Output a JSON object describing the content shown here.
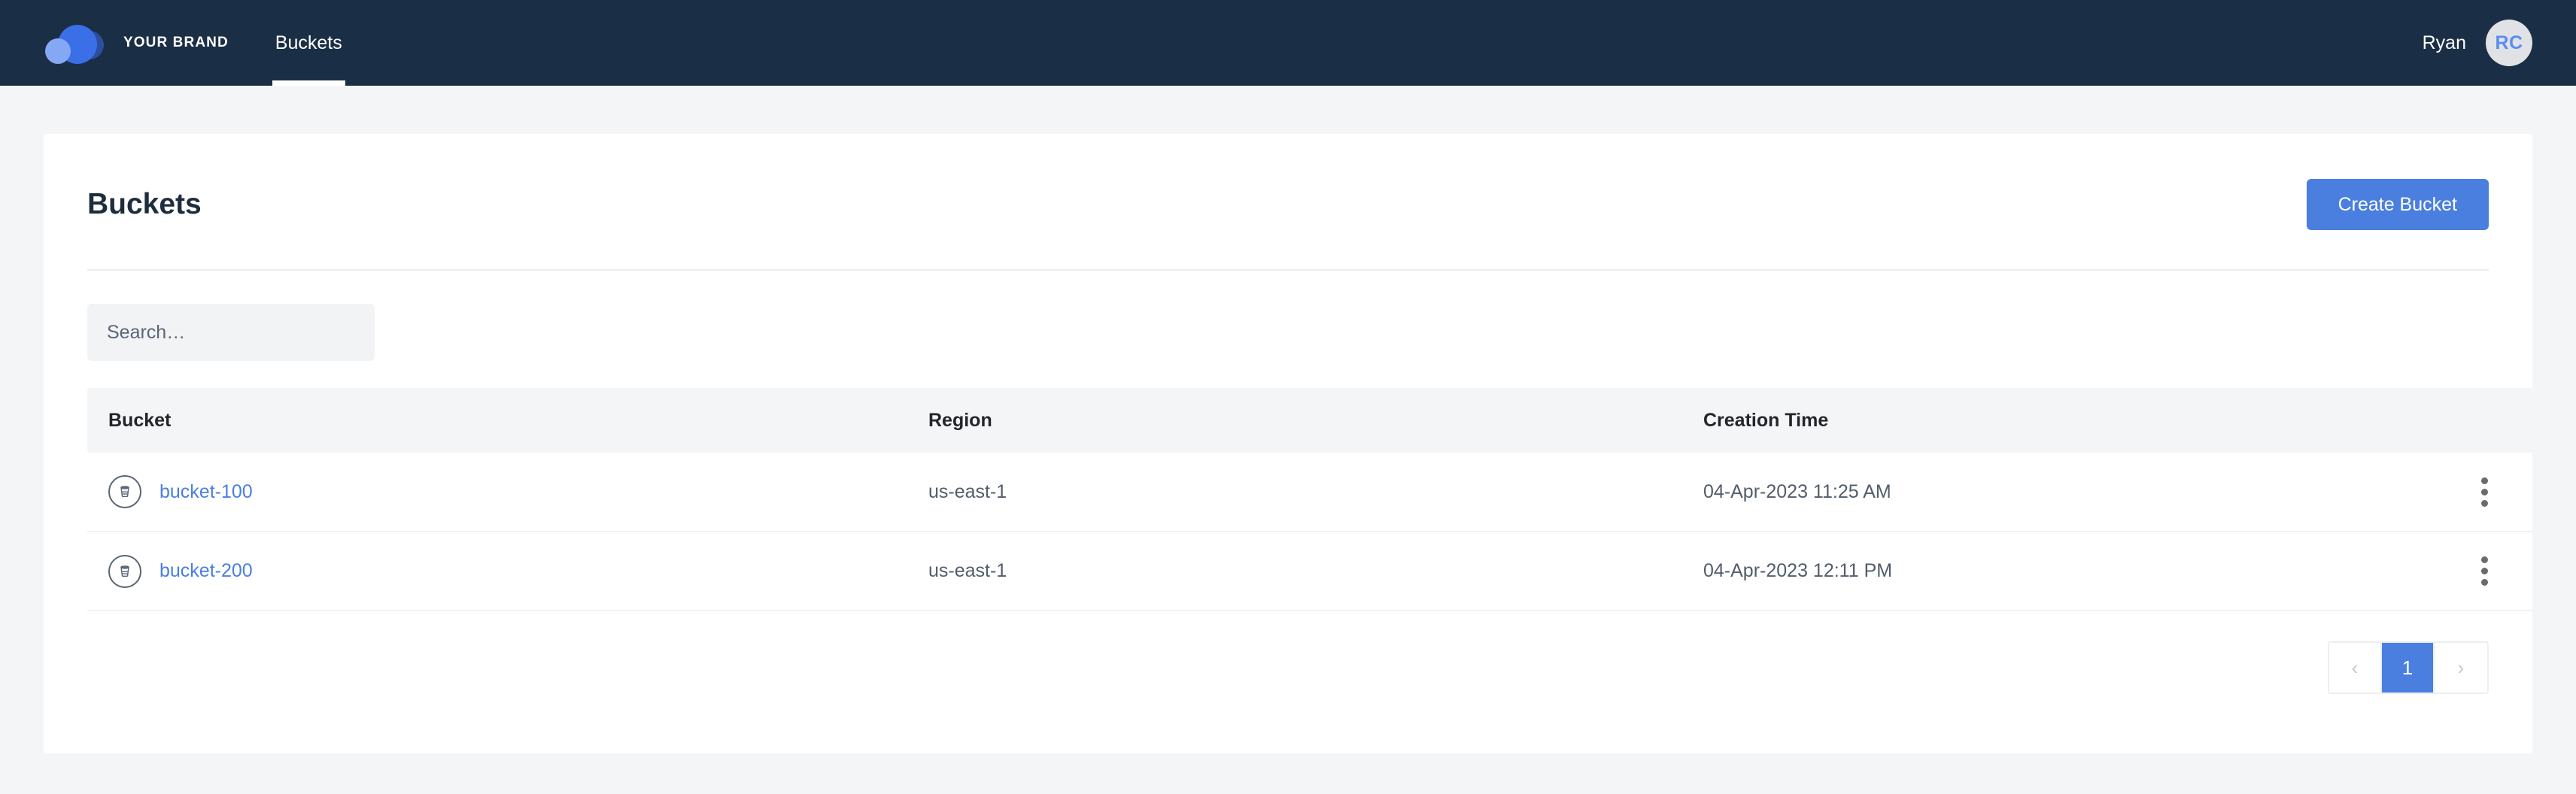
{
  "navbar": {
    "brand_name": "YOUR BRAND",
    "logo_icon": "cloud-circles-logo",
    "tabs": [
      {
        "label": "Buckets",
        "active": true
      }
    ],
    "user": {
      "name": "Ryan",
      "avatar_initials": "RC"
    }
  },
  "page": {
    "title": "Buckets",
    "create_button": "Create Bucket"
  },
  "search": {
    "value": "",
    "placeholder": "Search…"
  },
  "table": {
    "columns": [
      "Bucket",
      "Region",
      "Creation Time"
    ],
    "rows": [
      {
        "icon": "bucket-icon",
        "bucket": "bucket-100",
        "region": "us-east-1",
        "creation_time": "04-Apr-2023 11:25 AM",
        "menu_icon": "kebab-menu-icon"
      },
      {
        "icon": "bucket-icon",
        "bucket": "bucket-200",
        "region": "us-east-1",
        "creation_time": "04-Apr-2023 12:11 PM",
        "menu_icon": "kebab-menu-icon"
      }
    ]
  },
  "pagination": {
    "prev_label": "‹",
    "next_label": "›",
    "pages": [
      "1"
    ],
    "current_page": "1"
  },
  "colors": {
    "navbar_bg": "#1a2e45",
    "accent_blue": "#4a7fe0",
    "page_bg": "#f4f5f7",
    "card_bg": "#ffffff",
    "link_blue": "#4a7fe0",
    "text_dark": "#1e2d3d",
    "text_muted": "#525d6b"
  }
}
